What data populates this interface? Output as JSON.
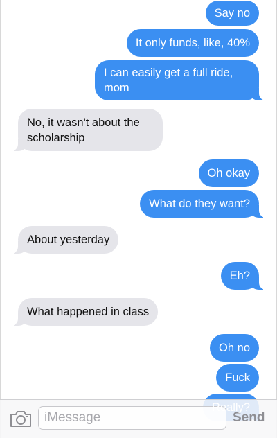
{
  "conversation": {
    "messages": [
      {
        "from": "me",
        "text": "Say no"
      },
      {
        "from": "me",
        "text": "It only funds, like, 40%"
      },
      {
        "from": "me",
        "text": "I can easily get a full ride, mom"
      },
      {
        "from": "them",
        "text": "No, it wasn't about the scholarship"
      },
      {
        "from": "me",
        "text": "Oh okay"
      },
      {
        "from": "me",
        "text": "What do they want?"
      },
      {
        "from": "them",
        "text": "About yesterday"
      },
      {
        "from": "me",
        "text": "Eh?"
      },
      {
        "from": "them",
        "text": "What happened in class"
      },
      {
        "from": "me",
        "text": "Oh no"
      },
      {
        "from": "me",
        "text": "Fuck"
      },
      {
        "from": "me",
        "text": "Really?"
      }
    ]
  },
  "composer": {
    "camera_icon": "camera-icon",
    "input_placeholder": "iMessage",
    "input_value": "",
    "send_label": "Send"
  },
  "colors": {
    "sent_bubble": "#3b8ff2",
    "received_bubble": "#e5e5ea",
    "send_label": "#8e8e93"
  }
}
